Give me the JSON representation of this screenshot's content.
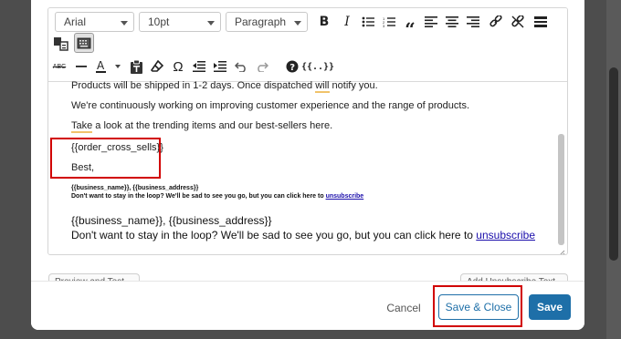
{
  "toolbar": {
    "font_family": "Arial",
    "font_size": "10pt",
    "block_format": "Paragraph",
    "merge_tags_label": "{{..}}",
    "icons_row1": [
      "bold-icon",
      "italic-icon",
      "bullet-list-icon",
      "numbered-list-icon",
      "blockquote-icon",
      "align-left-icon",
      "align-center-icon",
      "align-right-icon",
      "link-icon",
      "unlink-icon",
      "horizontal-rule-icon"
    ],
    "icons_row3": [
      "strikethrough-icon",
      "horizontal-line-icon",
      "text-color-icon",
      "paste-as-text-icon",
      "clear-formatting-icon",
      "special-character-icon",
      "outdent-icon",
      "indent-icon",
      "undo-icon",
      "redo-icon",
      "help-icon",
      "merge-tags-icon"
    ]
  },
  "content": {
    "line1_before": "Products will be shipped in 1-2 days. Once dispatched ",
    "line1_word": "will",
    "line1_after": " notify you.",
    "line2": "We're continuously working on improving customer experience and the range of products.",
    "line3_word": "Take",
    "line3_after": " a look at the trending items and our best-sellers here.",
    "cross_sells": "{{order_cross_sells}}",
    "sign_off": "Best,",
    "small_business": "{{business_name}}, {{business_address}}",
    "small_unsub_text": "Don't want to stay in the loop? We'll be sad to see you go, but you can click here to ",
    "unsubscribe_link": "unsubscribe",
    "big_business": "{{business_name}}, {{business_address}}",
    "big_unsub_text": "Don't want to stay in the loop? We'll be sad to see you go, but you can click here to "
  },
  "ghost_buttons": {
    "preview_test": "Preview and Test",
    "add_unsubscribe": "Add Unsubscribe Text"
  },
  "footer": {
    "cancel": "Cancel",
    "save_close": "Save & Close",
    "save": "Save"
  },
  "colors": {
    "primary": "#1e6fa8",
    "highlight_red": "#d10000",
    "link": "#1a0dab"
  }
}
